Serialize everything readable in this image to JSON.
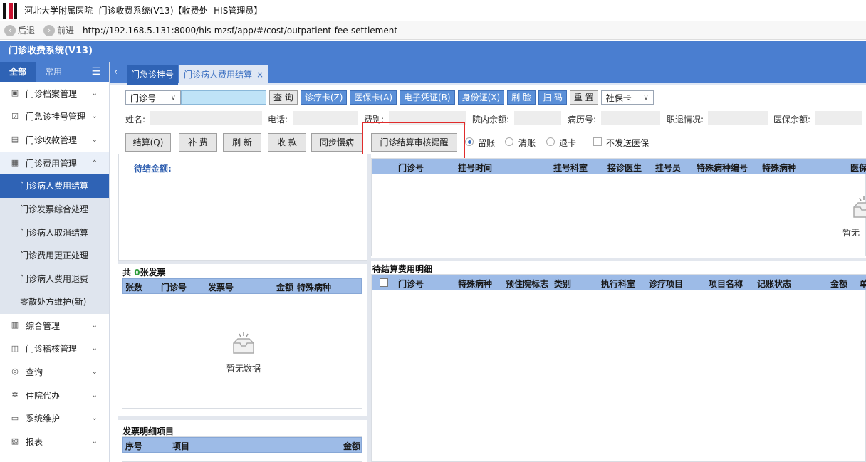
{
  "window": {
    "title": "河北大学附属医院--门诊收费系统(V13)【收费处--HIS管理员】"
  },
  "browser": {
    "back_label": "后退",
    "forward_label": "前进",
    "url": "http://192.168.5.131:8000/his-mzsf/app/#/cost/outpatient-fee-settlement"
  },
  "app": {
    "title": "门诊收费系统(V13)"
  },
  "sidebar": {
    "tab_all": "全部",
    "tab_common": "常用",
    "items": [
      {
        "label": "门诊档案管理",
        "icon": "doc-icon"
      },
      {
        "label": "门急诊挂号管理",
        "icon": "register-icon"
      },
      {
        "label": "门诊收款管理",
        "icon": "cash-icon"
      },
      {
        "label": "门诊费用管理",
        "icon": "fee-icon"
      }
    ],
    "subitems": [
      "门诊病人费用结算",
      "门诊发票综合处理",
      "门诊病人取消结算",
      "门诊费用更正处理",
      "门诊病人费用退费",
      "零散处方维护(新)"
    ],
    "items2": [
      {
        "label": "综合管理",
        "icon": "building-icon"
      },
      {
        "label": "门诊稽核管理",
        "icon": "audit-icon"
      },
      {
        "label": "查询",
        "icon": "search-icon"
      },
      {
        "label": "住院代办",
        "icon": "gear-icon"
      },
      {
        "label": "系统维护",
        "icon": "monitor-icon"
      },
      {
        "label": "报表",
        "icon": "report-icon"
      }
    ]
  },
  "tabs": {
    "tab1": "门急诊挂号",
    "tab2": "门诊病人费用结算",
    "close": "×"
  },
  "toolbar1": {
    "select_value": "门诊号",
    "input_value": "",
    "query": "查 询",
    "clinic_card": "诊疗卡(Z)",
    "insurance_card": "医保卡(A)",
    "e_voucher": "电子凭证(B)",
    "id_card": "身份证(X)",
    "face": "刷 脸",
    "scan": "扫 码",
    "reset": "重 置",
    "card_type": "社保卡"
  },
  "info": {
    "name_label": "姓名:",
    "phone_label": "电话:",
    "fee_type_label": "费别:",
    "hospital_balance_label": "院内余额:",
    "record_no_label": "病历号:",
    "retire_label": "职退情况:",
    "insurance_balance_label": "医保余额:"
  },
  "toolbar2": {
    "settle": "结算(Q)",
    "supplement": "补 费",
    "refresh": "刷 新",
    "collect": "收 款",
    "sync_chronic": "同步慢病",
    "audit_remind": "门诊结算审核提醒",
    "radio_keep": "留账",
    "radio_clear": "清账",
    "radio_refund": "退卡",
    "no_send_insurance": "不发送医保"
  },
  "pending": {
    "label": "待结金额:",
    "value": ""
  },
  "invoice": {
    "count_prefix": "共 ",
    "count": "0",
    "count_suffix": "张发票",
    "columns": [
      "张数",
      "门诊号",
      "发票号",
      "金额",
      "特殊病种"
    ],
    "empty_text": "暂无数据"
  },
  "invoice_detail": {
    "title": "发票明细项目",
    "columns": [
      "序号",
      "项目",
      "金额"
    ]
  },
  "visit_grid": {
    "columns": [
      "门诊号",
      "挂号时间",
      "挂号科室",
      "接诊医生",
      "挂号员",
      "特殊病种编号",
      "特殊病种",
      "医保"
    ],
    "empty_text": "暂无"
  },
  "fee_detail": {
    "title": "待结算费用明细",
    "columns": [
      "门诊号",
      "特殊病种",
      "预住院标志",
      "类别",
      "执行科室",
      "诊疗项目",
      "项目名称",
      "记账状态",
      "金额",
      "单"
    ]
  }
}
